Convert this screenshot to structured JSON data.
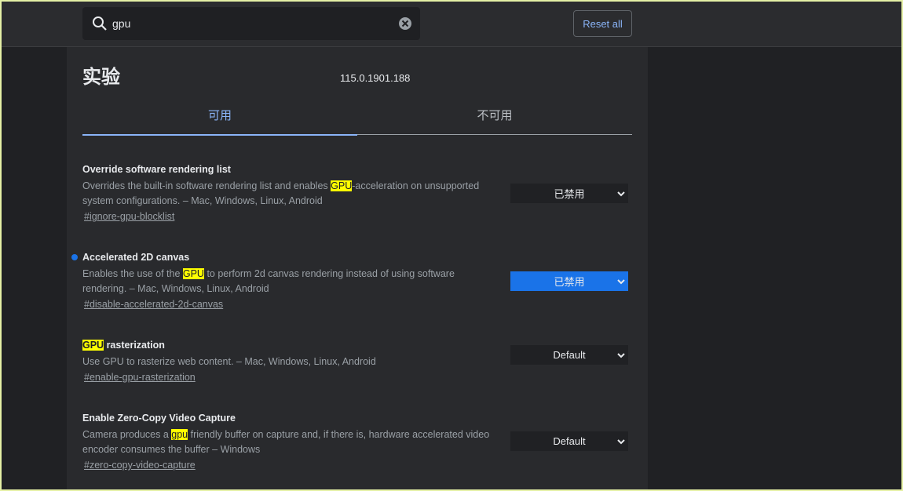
{
  "search": {
    "value": "gpu",
    "placeholder": ""
  },
  "reset_label": "Reset all",
  "title": "实验",
  "version": "115.0.1901.188",
  "tabs": [
    {
      "label": "可用"
    },
    {
      "label": "不可用"
    }
  ],
  "experiments": [
    {
      "title": "Override software rendering list",
      "title_parts": {
        "hl": "",
        "rest": ""
      },
      "desc_pre": "Overrides the built-in software rendering list and enables ",
      "desc_hl": "GPU",
      "desc_post": "-acceleration on unsupported system configurations. – Mac, Windows, Linux, Android",
      "link": "#ignore-gpu-blocklist",
      "value": "已禁用",
      "modified": false
    },
    {
      "title": "Accelerated 2D canvas",
      "desc_pre": "Enables the use of the ",
      "desc_hl": "GPU",
      "desc_post": " to perform 2d canvas rendering instead of using software rendering. – Mac, Windows, Linux, Android",
      "link": "#disable-accelerated-2d-canvas",
      "value": "已禁用",
      "modified": true
    },
    {
      "title_hl": "GPU",
      "title_rest": " rasterization",
      "desc": "Use GPU to rasterize web content. – Mac, Windows, Linux, Android",
      "link": "#enable-gpu-rasterization",
      "value": "Default",
      "modified": false
    },
    {
      "title": "Enable Zero-Copy Video Capture",
      "desc_pre": "Camera produces a ",
      "desc_hl": "gpu",
      "desc_post": " friendly buffer on capture and, if there is, hardware accelerated video encoder consumes the buffer – Windows",
      "link": "#zero-copy-video-capture",
      "value": "Default",
      "modified": false
    }
  ],
  "colors": {
    "background": "#202124",
    "panel": "#292a2d",
    "accent": "#8ab4f8",
    "modified_select": "#1a73e8",
    "highlight": "#ffff00"
  },
  "icons": {
    "search": "search-icon",
    "clear": "clear-icon",
    "chevron": "chevron-down-icon"
  }
}
